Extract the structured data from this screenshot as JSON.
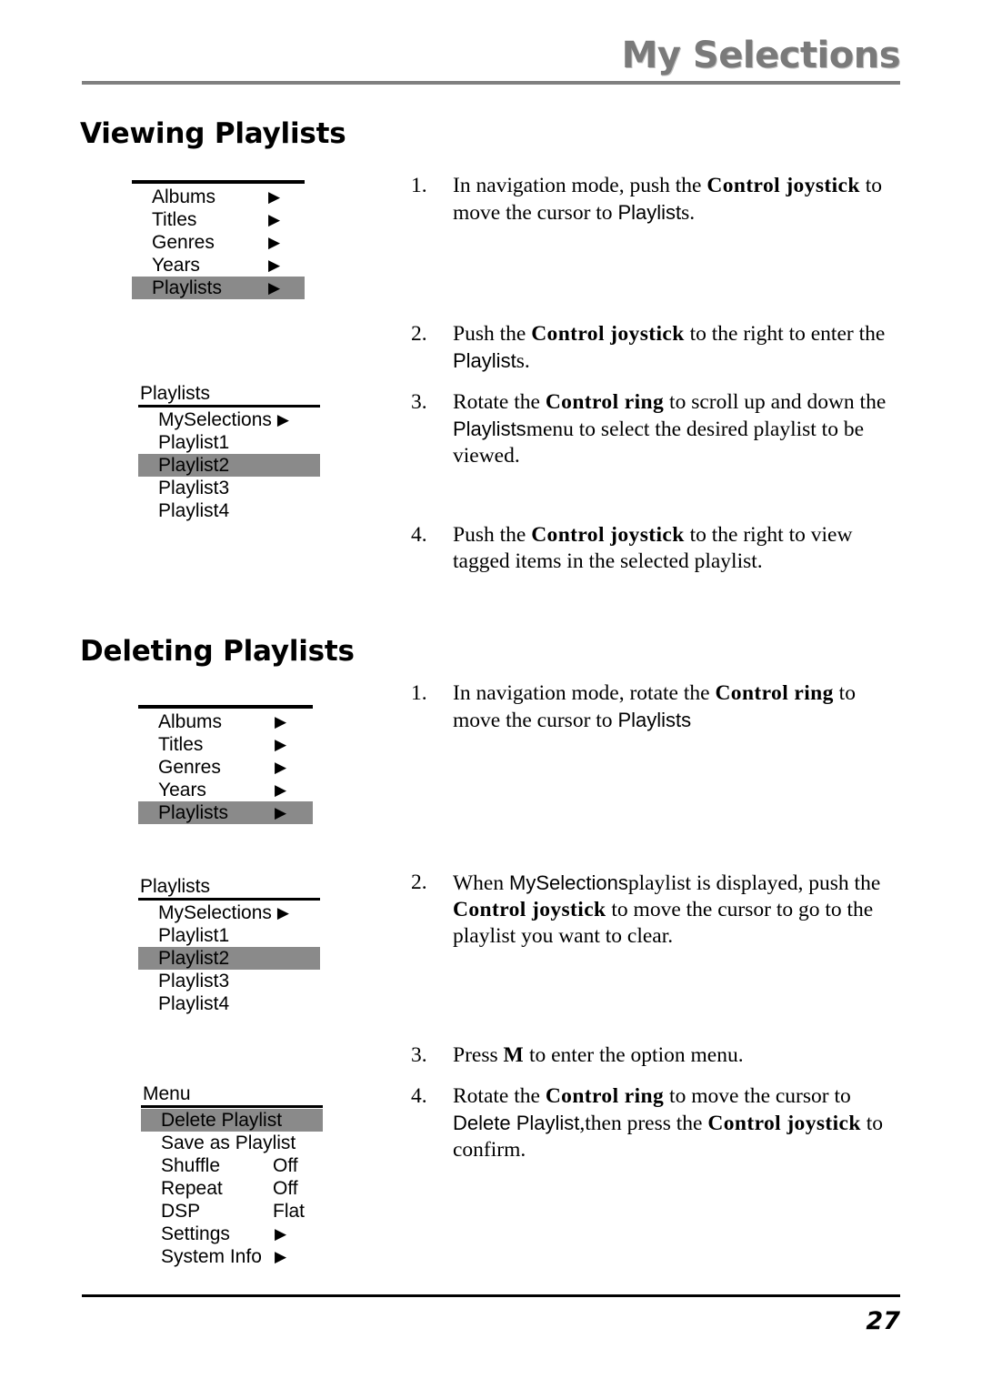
{
  "header": {
    "title": "My Selections"
  },
  "footer": {
    "page_number": "27"
  },
  "colors": {
    "header_text": "#7a7a7a",
    "header_rule": "#808080",
    "menu_highlight": "#8a8a8a",
    "text": "#000000"
  },
  "sections": {
    "viewing": {
      "heading": "Viewing Playlists",
      "menu_main": {
        "rows": [
          {
            "label": "Albums",
            "arrow": "▶",
            "selected": false
          },
          {
            "label": "Titles",
            "arrow": "▶",
            "selected": false
          },
          {
            "label": "Genres",
            "arrow": "▶",
            "selected": false
          },
          {
            "label": "Years",
            "arrow": "▶",
            "selected": false
          },
          {
            "label": "Playlists",
            "arrow": "▶",
            "selected": true
          }
        ]
      },
      "menu_playlists": {
        "caption": "Playlists",
        "rows": [
          {
            "label": "MySelections",
            "arrow": "▶",
            "selected": false
          },
          {
            "label": "Playlist1",
            "arrow": "",
            "selected": false
          },
          {
            "label": "Playlist2",
            "arrow": "",
            "selected": true
          },
          {
            "label": "Playlist3",
            "arrow": "",
            "selected": false
          },
          {
            "label": "Playlist4",
            "arrow": "",
            "selected": false
          }
        ]
      },
      "steps": [
        {
          "num": "1.",
          "parts": [
            {
              "t": "In navigation mode, push the ",
              "s": "plain"
            },
            {
              "t": "Control joystick",
              "s": "bold"
            },
            {
              "t": " to move the cursor to ",
              "s": "plain"
            },
            {
              "t": "Playlist",
              "s": "screen"
            },
            {
              "t": "s.",
              "s": "plain"
            }
          ]
        },
        {
          "num": "2.",
          "parts": [
            {
              "t": "Push the ",
              "s": "plain"
            },
            {
              "t": "Control joystick",
              "s": "bold"
            },
            {
              "t": " to the right to enter the ",
              "s": "plain"
            },
            {
              "t": "Playlist",
              "s": "screen"
            },
            {
              "t": "s.",
              "s": "plain"
            }
          ]
        },
        {
          "num": "3.",
          "parts": [
            {
              "t": "Rotate the ",
              "s": "plain"
            },
            {
              "t": "Control ring",
              "s": "bold"
            },
            {
              "t": " to scroll up and down the ",
              "s": "plain"
            },
            {
              "t": "Playlists",
              "s": "screen"
            },
            {
              "t": "menu to select the desired playlist to be viewed.",
              "s": "plain"
            }
          ]
        },
        {
          "num": "4.",
          "parts": [
            {
              "t": "Push the ",
              "s": "plain"
            },
            {
              "t": "Control joystick",
              "s": "bold"
            },
            {
              "t": " to the right to view tagged items in the selected playlist.",
              "s": "plain"
            }
          ]
        }
      ]
    },
    "deleting": {
      "heading": "Deleting Playlists",
      "menu_main": {
        "rows": [
          {
            "label": "Albums",
            "arrow": "▶",
            "selected": false
          },
          {
            "label": "Titles",
            "arrow": "▶",
            "selected": false
          },
          {
            "label": "Genres",
            "arrow": "▶",
            "selected": false
          },
          {
            "label": "Years",
            "arrow": "▶",
            "selected": false
          },
          {
            "label": "Playlists",
            "arrow": "▶",
            "selected": true
          }
        ]
      },
      "menu_playlists": {
        "caption": "Playlists",
        "rows": [
          {
            "label": "MySelections",
            "arrow": "▶",
            "selected": false
          },
          {
            "label": "Playlist1",
            "arrow": "",
            "selected": false
          },
          {
            "label": "Playlist2",
            "arrow": "",
            "selected": true
          },
          {
            "label": "Playlist3",
            "arrow": "",
            "selected": false
          },
          {
            "label": "Playlist4",
            "arrow": "",
            "selected": false
          }
        ]
      },
      "menu_options": {
        "caption": "Menu",
        "rows": [
          {
            "label": "Delete Playlist",
            "value": "",
            "arrow": "",
            "selected": true
          },
          {
            "label": "Save as Playlist",
            "value": "",
            "arrow": "",
            "selected": false
          },
          {
            "label": "Shuffle",
            "value": "Off",
            "arrow": "",
            "selected": false
          },
          {
            "label": "Repeat",
            "value": "Off",
            "arrow": "",
            "selected": false
          },
          {
            "label": "DSP",
            "value": "Flat",
            "arrow": "",
            "selected": false
          },
          {
            "label": "Settings",
            "value": "",
            "arrow": "▶",
            "selected": false
          },
          {
            "label": "System Info",
            "value": "",
            "arrow": "▶",
            "selected": false
          }
        ]
      },
      "steps": [
        {
          "num": "1.",
          "parts": [
            {
              "t": "In navigation mode, rotate the ",
              "s": "plain"
            },
            {
              "t": "Control ring",
              "s": "bold"
            },
            {
              "t": " to move the cursor to ",
              "s": "plain"
            },
            {
              "t": "Playlists",
              "s": "screen"
            }
          ]
        },
        {
          "num": "2.",
          "parts": [
            {
              "t": "When ",
              "s": "plain"
            },
            {
              "t": "MySelections",
              "s": "screen"
            },
            {
              "t": "playlist is displayed, push the ",
              "s": "plain"
            },
            {
              "t": "Control joystick",
              "s": "bold"
            },
            {
              "t": " to move the cursor to go to the playlist you want to clear.",
              "s": "plain"
            }
          ]
        },
        {
          "num": "3.",
          "parts": [
            {
              "t": "Press ",
              "s": "plain"
            },
            {
              "t": "M",
              "s": "bold"
            },
            {
              "t": " to enter the option menu.",
              "s": "plain"
            }
          ]
        },
        {
          "num": "4.",
          "parts": [
            {
              "t": "Rotate the ",
              "s": "plain"
            },
            {
              "t": "Control ring",
              "s": "bold"
            },
            {
              "t": " to move the cursor to ",
              "s": "plain"
            },
            {
              "t": "Delete Playlist",
              "s": "screen"
            },
            {
              "t": ",then press the ",
              "s": "plain"
            },
            {
              "t": "Control joystick",
              "s": "bold"
            },
            {
              "t": " to confirm.",
              "s": "plain"
            }
          ]
        }
      ]
    }
  }
}
